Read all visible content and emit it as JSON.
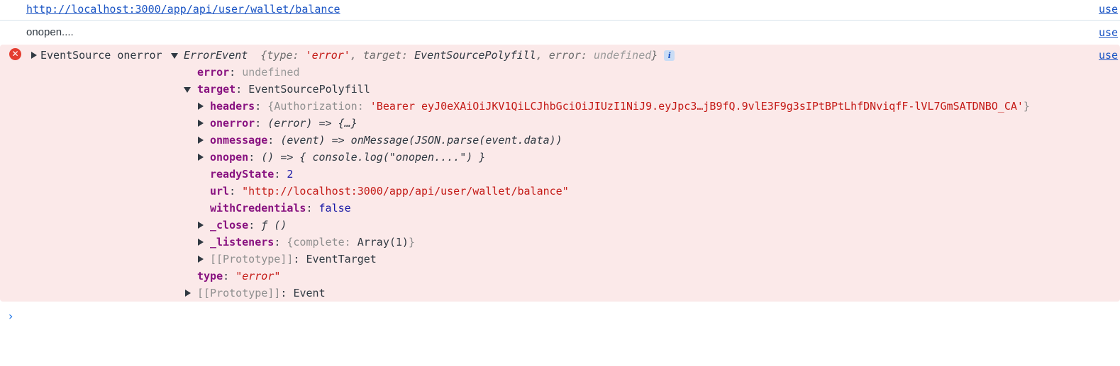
{
  "messages": [
    {
      "kind": "log-link",
      "text": "http://localhost:3000/app/api/user/wallet/balance",
      "source": "use"
    },
    {
      "kind": "log",
      "text": "onopen....",
      "source": "use"
    }
  ],
  "error_message": {
    "source": "use",
    "label": "EventSource onerror",
    "object_type": "ErrorEvent",
    "preview": {
      "open": "{type: ",
      "type_value": "'error'",
      "sep1": ", target: ",
      "target_value": "EventSourcePolyfill",
      "sep2": ", error: ",
      "error_value": "undefined",
      "close": "}"
    },
    "info_badge": "i",
    "props": {
      "error_key": "error",
      "error_value": "undefined",
      "target_key": "target",
      "target_value": "EventSourcePolyfill",
      "type_key": "type",
      "type_value": "\"error\"",
      "prototype_key": "[[Prototype]]",
      "prototype_value": "Event"
    },
    "target_props": {
      "headers_key": "headers",
      "headers_open": "{",
      "headers_auth_key": "Authorization",
      "headers_auth_value": "'Bearer eyJ0eXAiOiJKV1QiLCJhbGciOiJIUzI1NiJ9.eyJpc3…jB9fQ.9vlE3F9g3sIPtBPtLhfDNviqfF-lVL7GmSATDNBO_CA'",
      "headers_close": "}",
      "onerror_key": "onerror",
      "onerror_value": "(error) => {…}",
      "onmessage_key": "onmessage",
      "onmessage_value": "(event) => onMessage(JSON.parse(event.data))",
      "onopen_key": "onopen",
      "onopen_value": "() => { console.log(\"onopen....\") }",
      "readyState_key": "readyState",
      "readyState_value": "2",
      "url_key": "url",
      "url_value": "\"http://localhost:3000/app/api/user/wallet/balance\"",
      "withCredentials_key": "withCredentials",
      "withCredentials_value": "false",
      "close_key": "_close",
      "close_value": "ƒ ()",
      "listeners_key": "_listeners",
      "listeners_open": "{",
      "listeners_inner_key": "complete",
      "listeners_inner_value": "Array(1)",
      "listeners_close": "}",
      "prototype_key": "[[Prototype]]",
      "prototype_value": "EventTarget"
    }
  },
  "prompt_symbol": "›",
  "icons": {
    "error": "error-circle-icon",
    "expand_collapsed": "triangle-right-icon",
    "expand_open": "triangle-down-icon",
    "prompt": "chevron-right-icon"
  },
  "colors": {
    "error_background": "#fbe9e9",
    "error_icon": "#e43d30",
    "link": "#1a54c4",
    "property_key": "#881280",
    "string": "#c41a16",
    "number": "#1a1aa6",
    "prompt": "#1a73e8"
  }
}
